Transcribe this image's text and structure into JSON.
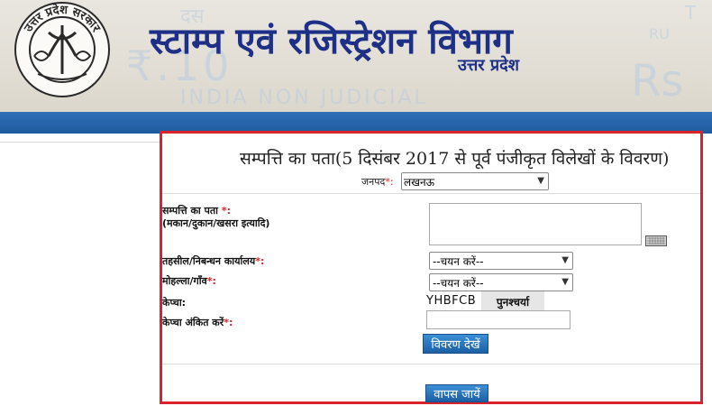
{
  "header": {
    "seal": {
      "label": "उत्तर प्रदेश सरकार"
    },
    "title": "स्टाम्प एवं रजिस्ट्रेशन विभाग",
    "subtitle": "उत्तर प्रदेश",
    "watermark": {
      "line1": "दस",
      "amount": "₹.10",
      "footer": "INDIA NON JUDICIAL",
      "right_big": "Rs",
      "right_mid": "RU",
      "right_top": "T"
    }
  },
  "form": {
    "title": "सम्पत्ति का पता(5 दिसंबर 2017 से पूर्व पंजीकृत विलेखों के विवरण)",
    "district": {
      "label": "जनपद",
      "required_mark": "*:",
      "value": "लखनऊ"
    },
    "address": {
      "label": "सम्पत्ति का पता",
      "required_mark": "*:",
      "hint": "(मकान/दुकान/खसरा इत्यादि)",
      "value": ""
    },
    "tehsil": {
      "label": "तहसील/निबन्धन कार्यालय",
      "required_mark": "*:",
      "value": "--चयन करें--"
    },
    "mohalla": {
      "label": "मोहल्ला/गाँव",
      "required_mark": "*:",
      "value": "--चयन करें--"
    },
    "captcha": {
      "label": "केप्चा:",
      "code": "YHBFCB",
      "refresh_label": "पुनश्चर्या"
    },
    "captcha_entry": {
      "label": "केप्चा अंकित करें",
      "required_mark": "*:",
      "value": ""
    },
    "view_button": "विवरण देखें",
    "back_button": "वापस जायें"
  },
  "icons": {
    "keyboard": "keyboard-icon",
    "select_arrow": "chevron-down-icon",
    "seal": "emblem-icon"
  },
  "colors": {
    "title_blue": "#1d2f86",
    "nav_blue": "#1f5a9e",
    "border_red": "#d8232a",
    "button_blue": "#1d5fa3"
  }
}
